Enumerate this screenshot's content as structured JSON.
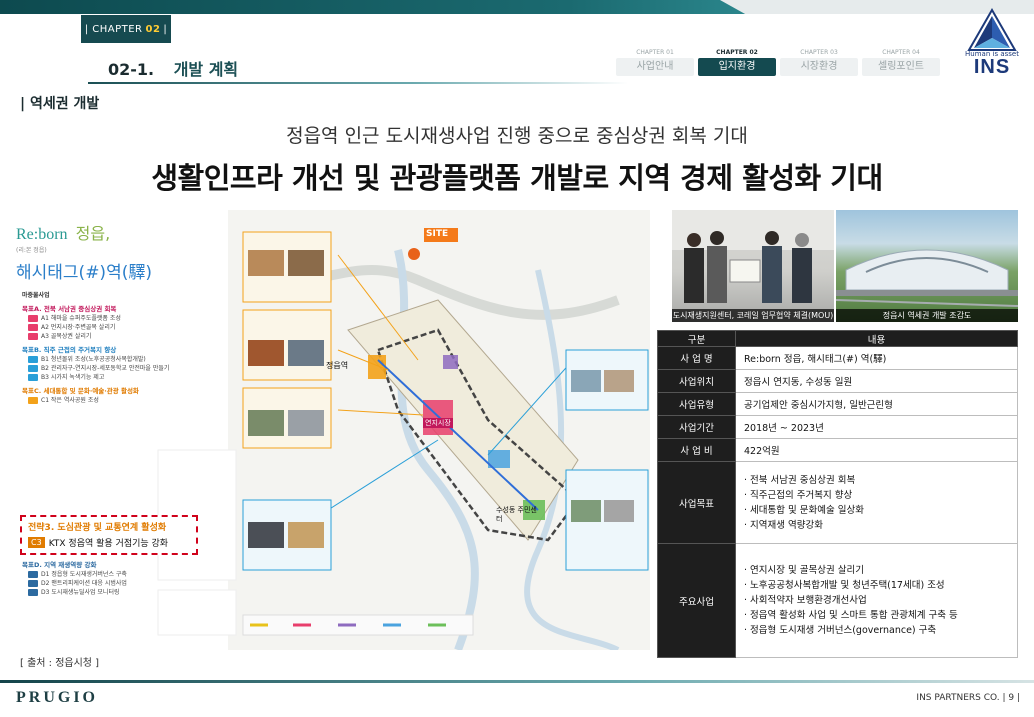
{
  "header": {
    "chapter_prefix": "| CHAPTER",
    "chapter_number": "02",
    "chapter_suffix": "|",
    "section_number": "02-1.",
    "section_title": "개발 계획"
  },
  "tabs": [
    {
      "small": "CHAPTER 01",
      "label": "사업안내",
      "active": false
    },
    {
      "small": "CHAPTER 02",
      "label": "입지환경",
      "active": true
    },
    {
      "small": "CHAPTER 03",
      "label": "시장환경",
      "active": false
    },
    {
      "small": "CHAPTER 04",
      "label": "셀링포인트",
      "active": false
    }
  ],
  "logo": {
    "tagline": "Human is asset",
    "name": "INS"
  },
  "sub_heading": "| 역세권 개발",
  "headline": {
    "line1": "정읍역 인근 도시재생사업 진행 중으로 중심상권 회복 기대",
    "line2": "생활인프라 개선 및 관광플랫폼 개발로 지역 경제 활성화 기대"
  },
  "map": {
    "brand_en": "Re:born",
    "brand_kr1": "정읍,",
    "brand_note": "(리:본 정읍)",
    "brand_kr2": "해시태그(#)역(驛)",
    "site_label": "SITE",
    "goals_title": "마중물사업",
    "goal_a": "목표A. 전북 서남권 중심상권 회복",
    "goal_a_items": [
      "A1 해마을 슈퍼주도플랫폼 조성",
      "A2 먼지시장·주변골목 살리기",
      "A3 골목상권 살리기"
    ],
    "goal_b": "목표B. 직주 근접의 주거복지 향상",
    "goal_b_items": [
      "B1 청년몰위 조성(노후공공청사복합개발)",
      "B2 관리자구-연지시장-세포동학교 안전마을 만들기",
      "B3 시가지 녹색기능 제고"
    ],
    "goal_c": "목표C. 세대통합 및 문화·예술·관광 활성화",
    "goal_c_items": [
      "C1 작은 역사공원 조성"
    ],
    "highlight_title": "전략3. 도심관광 및 교통연계 활성화",
    "highlight_chip": "C3",
    "highlight_text": "KTX 정읍역 활용 거점기능 강화",
    "goal_d": "목표D. 지역 재생역량 강화",
    "goal_d_items": [
      "D1 정읍형 도시재생거버넌스 구축",
      "D2 맨트리피케이션 대응 시범사업",
      "D3 도시재생뉴딜사업 모니터링"
    ],
    "area_label_1": "정읍역",
    "area_label_2": "연지시장",
    "area_label_3": "수성동 주민센터"
  },
  "photos": [
    {
      "caption": "도시재생지원센터, 코레일 업무협약 체결(MOU)"
    },
    {
      "caption": "정읍시 역세권 개발 조감도"
    }
  ],
  "source": "[ 출처 : 정읍시청 ]",
  "table": {
    "headers": [
      "구분",
      "내용"
    ],
    "rows": [
      {
        "key": "사 업 명",
        "value": "Re:born 정읍, 해시태그(#) 역(驛)"
      },
      {
        "key": "사업위치",
        "value": "정읍시 연지동, 수성동 일원"
      },
      {
        "key": "사업유형",
        "value": "공기업제안 중심시가지형, 일반근린형"
      },
      {
        "key": "사업기간",
        "value": "2018년 ~ 2023년"
      },
      {
        "key": "사 업 비",
        "value": "422억원"
      }
    ],
    "goals_key": "사업목표",
    "goals": [
      "전북 서남권 중심상권 회복",
      "직주근접의 주거복지 향상",
      "세대통합 및 문화예술 일상화",
      "지역재생 역량강화"
    ],
    "main_key": "주요사업",
    "main": [
      "연지시장 및 골목상권 살리기",
      "노후공공청사복합개발 및 청년주택(17세대) 조성",
      "사회적약자 보행환경개선사업",
      "정읍역 활성화 사업 및 스마트 통합 관광체계 구축 등",
      "정읍형 도시재생 거버넌스(governance) 구축"
    ]
  },
  "footer": {
    "brand": "PRUGIO",
    "company": "INS PARTNERS CO.",
    "page": "| 9 |"
  },
  "colors": {
    "primary": "#164a50",
    "accent": "#ffcc33",
    "highlight_border": "#d0021b",
    "table_dark": "#1e1e1e"
  }
}
